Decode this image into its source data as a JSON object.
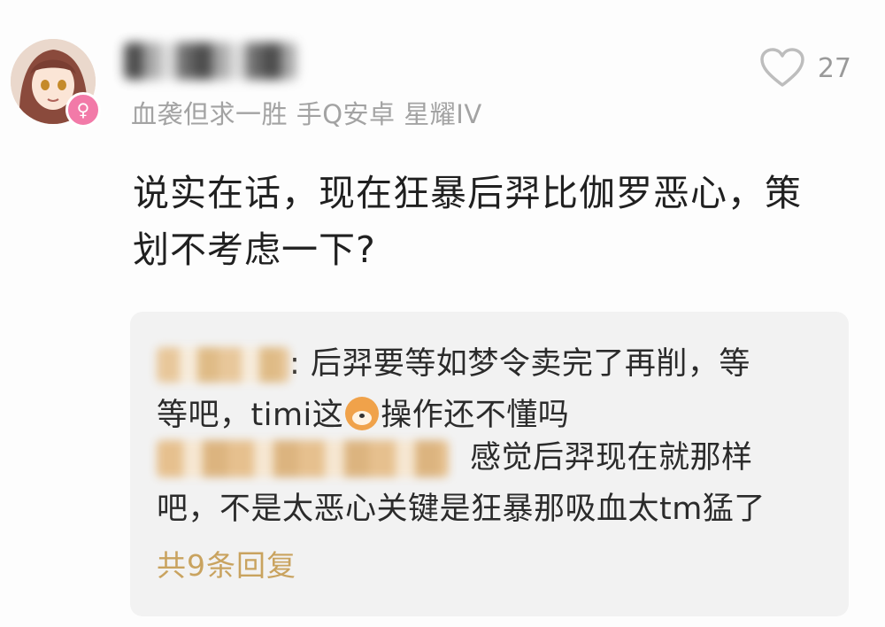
{
  "comment": {
    "user_meta": "血袭但求一胜 手Q安卓 星耀IV",
    "likes": "27",
    "text_line1": "说实在话，现在狂暴后羿比伽罗恶心，策",
    "text_line2": "划不考虑一下?"
  },
  "replies": {
    "reply1_sep": ":",
    "reply1_part1": " 后羿要等如梦令卖完了再削，等",
    "reply1_part2": "等吧，timi这",
    "reply1_part3": "操作还不懂吗",
    "reply2_part1": "感觉后羿现在就那样",
    "reply2_part2": "吧，不是太恶心关键是狂暴那吸血太tm猛了",
    "more_label": "共9条回复"
  },
  "colors": {
    "accent_gold": "#c9a35f",
    "gender_badge": "#f27aa8"
  },
  "icons": [
    "heart-icon",
    "female-icon",
    "dog-emoji-icon"
  ]
}
